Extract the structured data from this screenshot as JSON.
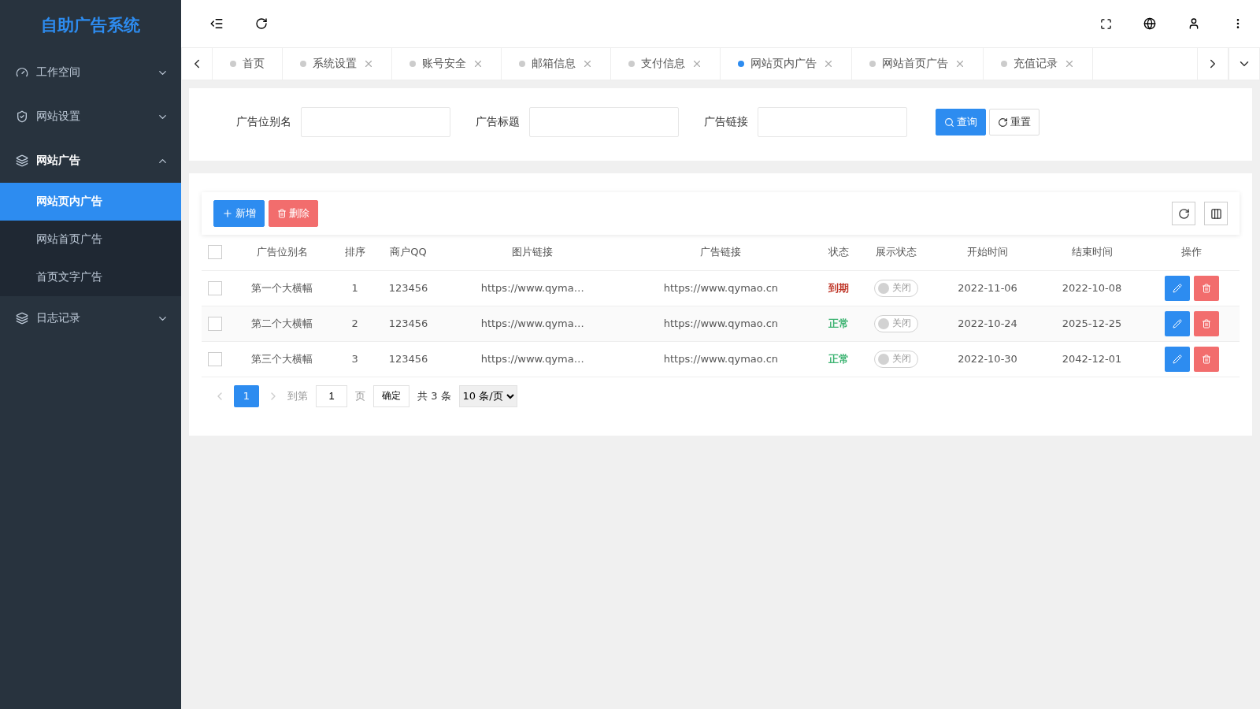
{
  "sidebar": {
    "title": "自助广告系统",
    "items": [
      {
        "label": "工作空间",
        "kind": "gauge",
        "expanded": false
      },
      {
        "label": "网站设置",
        "kind": "shield",
        "expanded": false
      },
      {
        "label": "网站广告",
        "kind": "layers",
        "expanded": true,
        "children": [
          {
            "label": "网站页内广告",
            "selected": true
          },
          {
            "label": "网站首页广告",
            "selected": false
          },
          {
            "label": "首页文字广告",
            "selected": false
          }
        ]
      },
      {
        "label": "日志记录",
        "kind": "layers",
        "expanded": false
      }
    ]
  },
  "tabs": [
    {
      "label": "首页",
      "selected": false,
      "closable": false
    },
    {
      "label": "系统设置",
      "selected": false,
      "closable": true
    },
    {
      "label": "账号安全",
      "selected": false,
      "closable": true
    },
    {
      "label": "邮箱信息",
      "selected": false,
      "closable": true
    },
    {
      "label": "支付信息",
      "selected": false,
      "closable": true
    },
    {
      "label": "网站页内广告",
      "selected": true,
      "closable": true
    },
    {
      "label": "网站首页广告",
      "selected": false,
      "closable": true
    },
    {
      "label": "充值记录",
      "selected": false,
      "closable": true
    }
  ],
  "filters": [
    {
      "label": "广告位别名"
    },
    {
      "label": "广告标题"
    },
    {
      "label": "广告链接"
    }
  ],
  "filter_buttons": {
    "search": "查询",
    "reset": "重置"
  },
  "toolbar": {
    "add": "新增",
    "delete": "删除"
  },
  "table": {
    "header_checked": false,
    "columns": [
      "广告位别名",
      "排序",
      "商户QQ",
      "图片链接",
      "广告链接",
      "状态",
      "展示状态",
      "开始时间",
      "结束时间",
      "操作"
    ],
    "rows": [
      {
        "checked": false,
        "name": "第一个大横幅",
        "order": "1",
        "qq": "123456",
        "image": "https://www.qyma…",
        "link": "https://www.qymao.cn",
        "status": "到期",
        "color": "#c0392b",
        "display": "关闭",
        "display_on": false,
        "start": "2022-11-06",
        "end": "2022-10-08"
      },
      {
        "checked": false,
        "name": "第二个大横幅",
        "order": "2",
        "qq": "123456",
        "image": "https://www.qyma…",
        "link": "https://www.qymao.cn",
        "status": "正常",
        "color": "#3cb371",
        "display": "关闭",
        "display_on": false,
        "start": "2022-10-24",
        "end": "2025-12-25"
      },
      {
        "checked": false,
        "name": "第三个大横幅",
        "order": "3",
        "qq": "123456",
        "image": "https://www.qyma…",
        "link": "https://www.qymao.cn",
        "status": "正常",
        "color": "#3cb371",
        "display": "关闭",
        "display_on": false,
        "start": "2022-10-30",
        "end": "2042-12-01"
      }
    ]
  },
  "pagination": {
    "pages": [
      {
        "label": "1",
        "selected": true
      }
    ],
    "goto_label": "到第",
    "goto_value": "1",
    "page_unit": "页",
    "confirm": "确定",
    "total": "共 3 条",
    "page_size": "10 条/页"
  }
}
